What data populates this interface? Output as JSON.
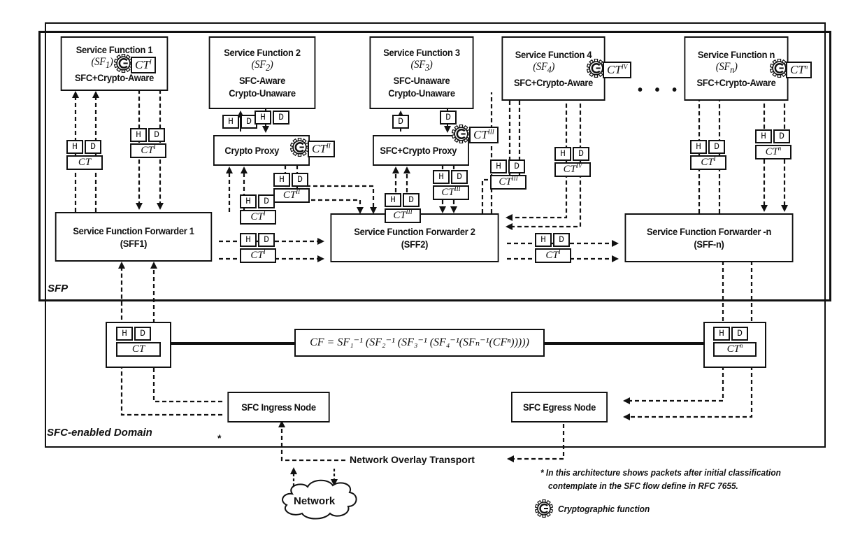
{
  "labels": {
    "sfp": "SFP",
    "domain": "SFC-enabled Domain",
    "ellipsis": "• • •"
  },
  "service_functions": [
    {
      "title": "Service Function 1",
      "symbol": "SF",
      "sub": "1",
      "lines": [
        "SFC+Crypto-Aware"
      ],
      "crypto_tag": {
        "base": "CT",
        "sup": "I"
      }
    },
    {
      "title": "Service Function 2",
      "symbol": "SF",
      "sub": "2",
      "lines": [
        "SFC-Aware",
        "Crypto-Unaware"
      ]
    },
    {
      "title": "Service Function 3",
      "symbol": "SF",
      "sub": "3",
      "lines": [
        "SFC-Unaware",
        "Crypto-Unaware"
      ]
    },
    {
      "title": "Service Function 4",
      "symbol": "SF",
      "sub": "4",
      "lines": [
        "SFC+Crypto-Aware"
      ],
      "crypto_tag": {
        "base": "CT",
        "sup": "IV"
      }
    },
    {
      "title": "Service Function n",
      "symbol": "SF",
      "sub": "n",
      "lines": [
        "SFC+Crypto-Aware"
      ],
      "crypto_tag": {
        "base": "CT",
        "sup": "n"
      }
    }
  ],
  "proxies": [
    {
      "label": "Crypto Proxy",
      "crypto_tag": {
        "base": "CT",
        "sup": "II"
      }
    },
    {
      "label": "SFC+Crypto Proxy",
      "crypto_tag": {
        "base": "CT",
        "sup": "III"
      }
    }
  ],
  "forwarders": [
    {
      "title": "Service Function Forwarder 1",
      "id": "(SFF1)"
    },
    {
      "title": "Service Function Forwarder 2",
      "id": "(SFF2)"
    },
    {
      "title": "Service Function Forwarder -n",
      "id": "(SFF-n)"
    }
  ],
  "packet": {
    "header": "H",
    "data": "D"
  },
  "packets": [
    {
      "ct": "CT",
      "sup": ""
    },
    {
      "ct": "CT",
      "sup": "I"
    },
    {
      "ct": "CT",
      "sup": "I"
    },
    {
      "ct": "CT",
      "sup": "II"
    },
    {
      "ct": "CT",
      "sup": "II"
    },
    {
      "ct": "CT",
      "sup": "III"
    },
    {
      "ct": "CT",
      "sup": "III"
    },
    {
      "ct": "CT",
      "sup": "IV"
    },
    {
      "ct": "CT",
      "sup": "I"
    },
    {
      "ct": "CT",
      "sup": "n"
    },
    {
      "ct": "CT",
      "sup": "I"
    },
    {
      "ct": "CT",
      "sup": "I"
    },
    {
      "ct": "CT",
      "sup": ""
    },
    {
      "ct": "CT",
      "sup": "n"
    }
  ],
  "nodes": {
    "ingress": "SFC Ingress Node",
    "egress": "SFC Egress Node",
    "transport": "Network Overlay Transport",
    "network": "Network",
    "asterisk": "*"
  },
  "formula": "CF = SF₁⁻¹ (SF₂⁻¹ (SF₃⁻¹ (SF₄⁻¹(SFₙ⁻¹(CFⁿ)))))",
  "notes": {
    "footnote_line1": "* In this architecture shows packets after initial classification",
    "footnote_line2": "contemplate in the SFC flow define in RFC 7655.",
    "legend": "Cryptographic function"
  }
}
